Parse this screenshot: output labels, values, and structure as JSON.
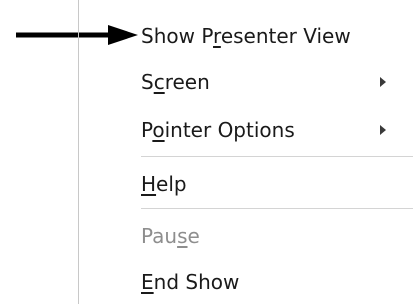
{
  "menu": {
    "items": [
      {
        "parts": [
          "Show P",
          "r",
          "esenter View"
        ],
        "enabled": true,
        "submenu": false
      },
      {
        "parts": [
          "S",
          "c",
          "reen"
        ],
        "enabled": true,
        "submenu": true
      },
      {
        "parts": [
          "P",
          "o",
          "inter Options"
        ],
        "enabled": true,
        "submenu": true
      },
      {
        "parts": [
          "",
          "H",
          "elp"
        ],
        "enabled": true,
        "submenu": false
      },
      {
        "parts": [
          "Pau",
          "s",
          "e"
        ],
        "enabled": false,
        "submenu": false
      },
      {
        "parts": [
          "",
          "E",
          "nd Show"
        ],
        "enabled": true,
        "submenu": false
      }
    ]
  },
  "colors": {
    "text": "#1a1a1a",
    "disabled_text": "#8e8e8e",
    "separator": "#d4d4d4",
    "pointer_arrow": "#000000"
  },
  "icons": {
    "pointer": "arrow-right-icon",
    "submenu": "chevron-right-icon"
  }
}
